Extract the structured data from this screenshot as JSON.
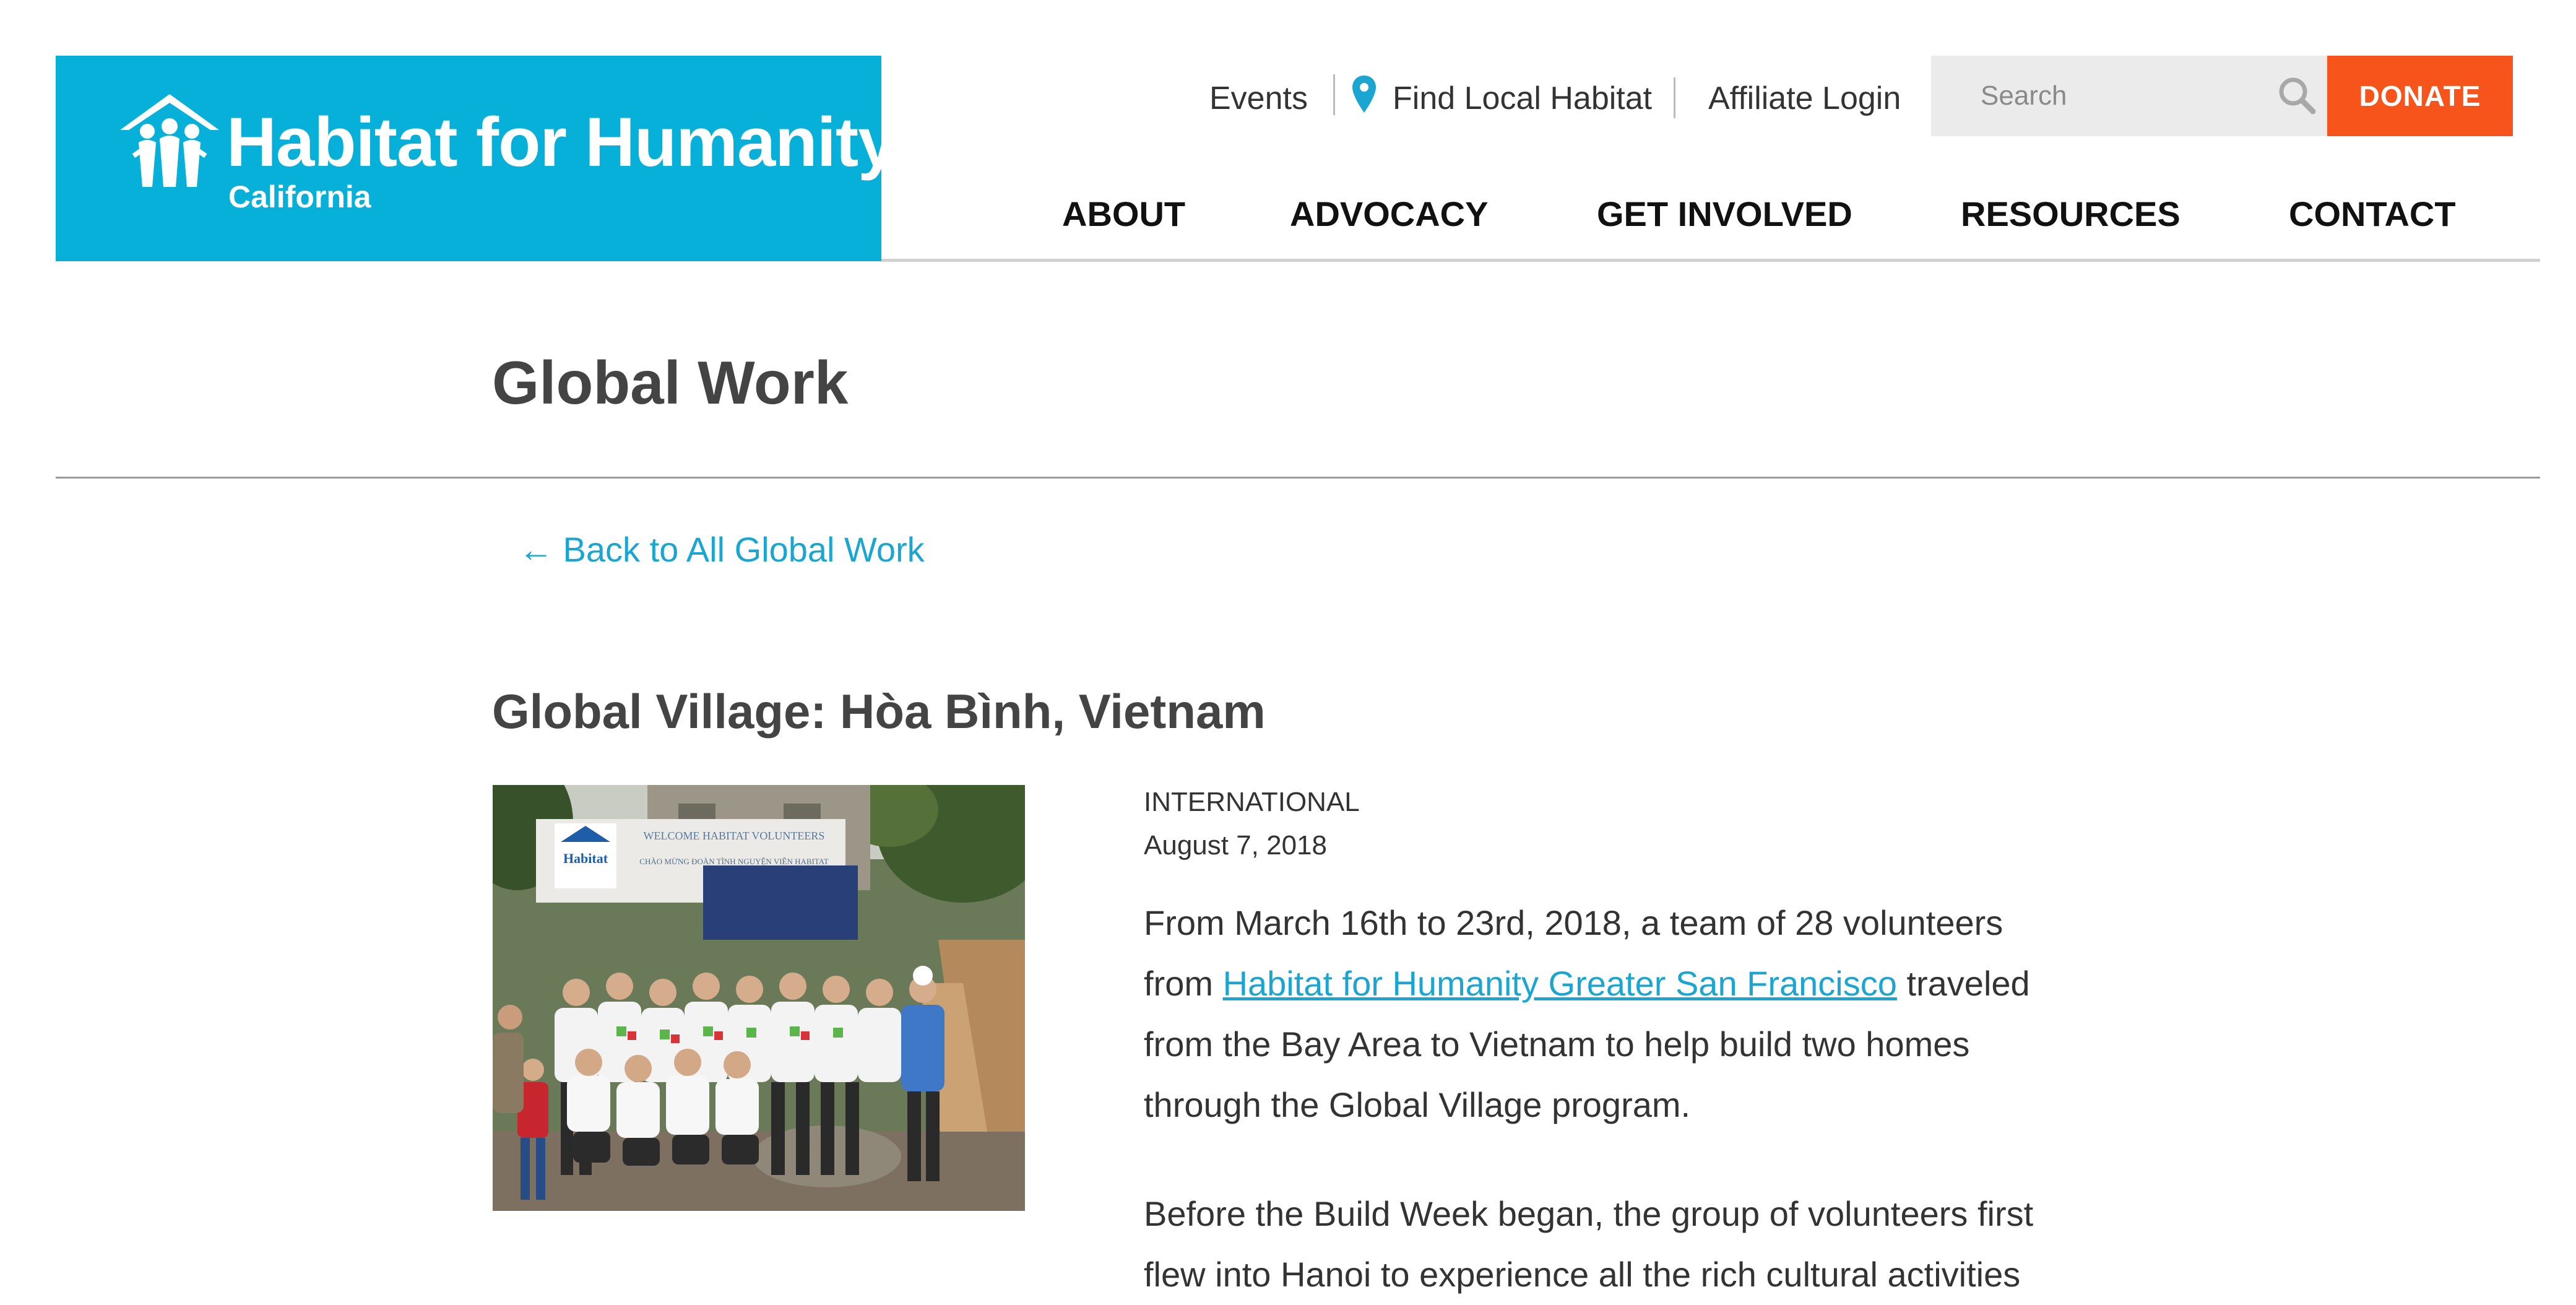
{
  "header": {
    "logo": {
      "title": "Habitat for Humanity",
      "trademark": "®",
      "subtitle": "California",
      "bg_color": "#07b0d8"
    },
    "utility": {
      "events": "Events",
      "find_local": "Find Local Habitat",
      "affiliate_login": "Affiliate Login"
    },
    "search": {
      "placeholder": "Search"
    },
    "donate": {
      "label": "DONATE",
      "color": "#f7541c"
    },
    "nav": [
      {
        "label": "ABOUT"
      },
      {
        "label": "ADVOCACY"
      },
      {
        "label": "GET INVOLVED"
      },
      {
        "label": "RESOURCES"
      },
      {
        "label": "CONTACT"
      }
    ]
  },
  "page": {
    "title": "Global Work",
    "back_link": "← Back to All Global Work"
  },
  "article": {
    "title": "Global Village: Hòa Bình, Vietnam",
    "category": "INTERNATIONAL",
    "date": "August 7, 2018",
    "para1": {
      "before": "From March 16th to 23rd, 2018, a team of 28 volunteers from ",
      "link": "Habitat for Humanity Greater San Francisco",
      "after": " traveled from the Bay Area to Vietnam to help build two homes through the Global Village program."
    },
    "para2": "Before the Build Week began, the group of volunteers first flew into Hanoi to experience all the rich cultural activities",
    "photo": {
      "banner_line1": "WELCOME HABITAT VOLUNTEERS",
      "banner_line2": "CHÀO MỪNG ĐOÀN TÌNH NGUYỆN VIÊN HABITAT",
      "banner_brand": "Habitat"
    }
  },
  "colors": {
    "link": "#1aa6d1",
    "text": "#333333",
    "heading": "#444444"
  }
}
